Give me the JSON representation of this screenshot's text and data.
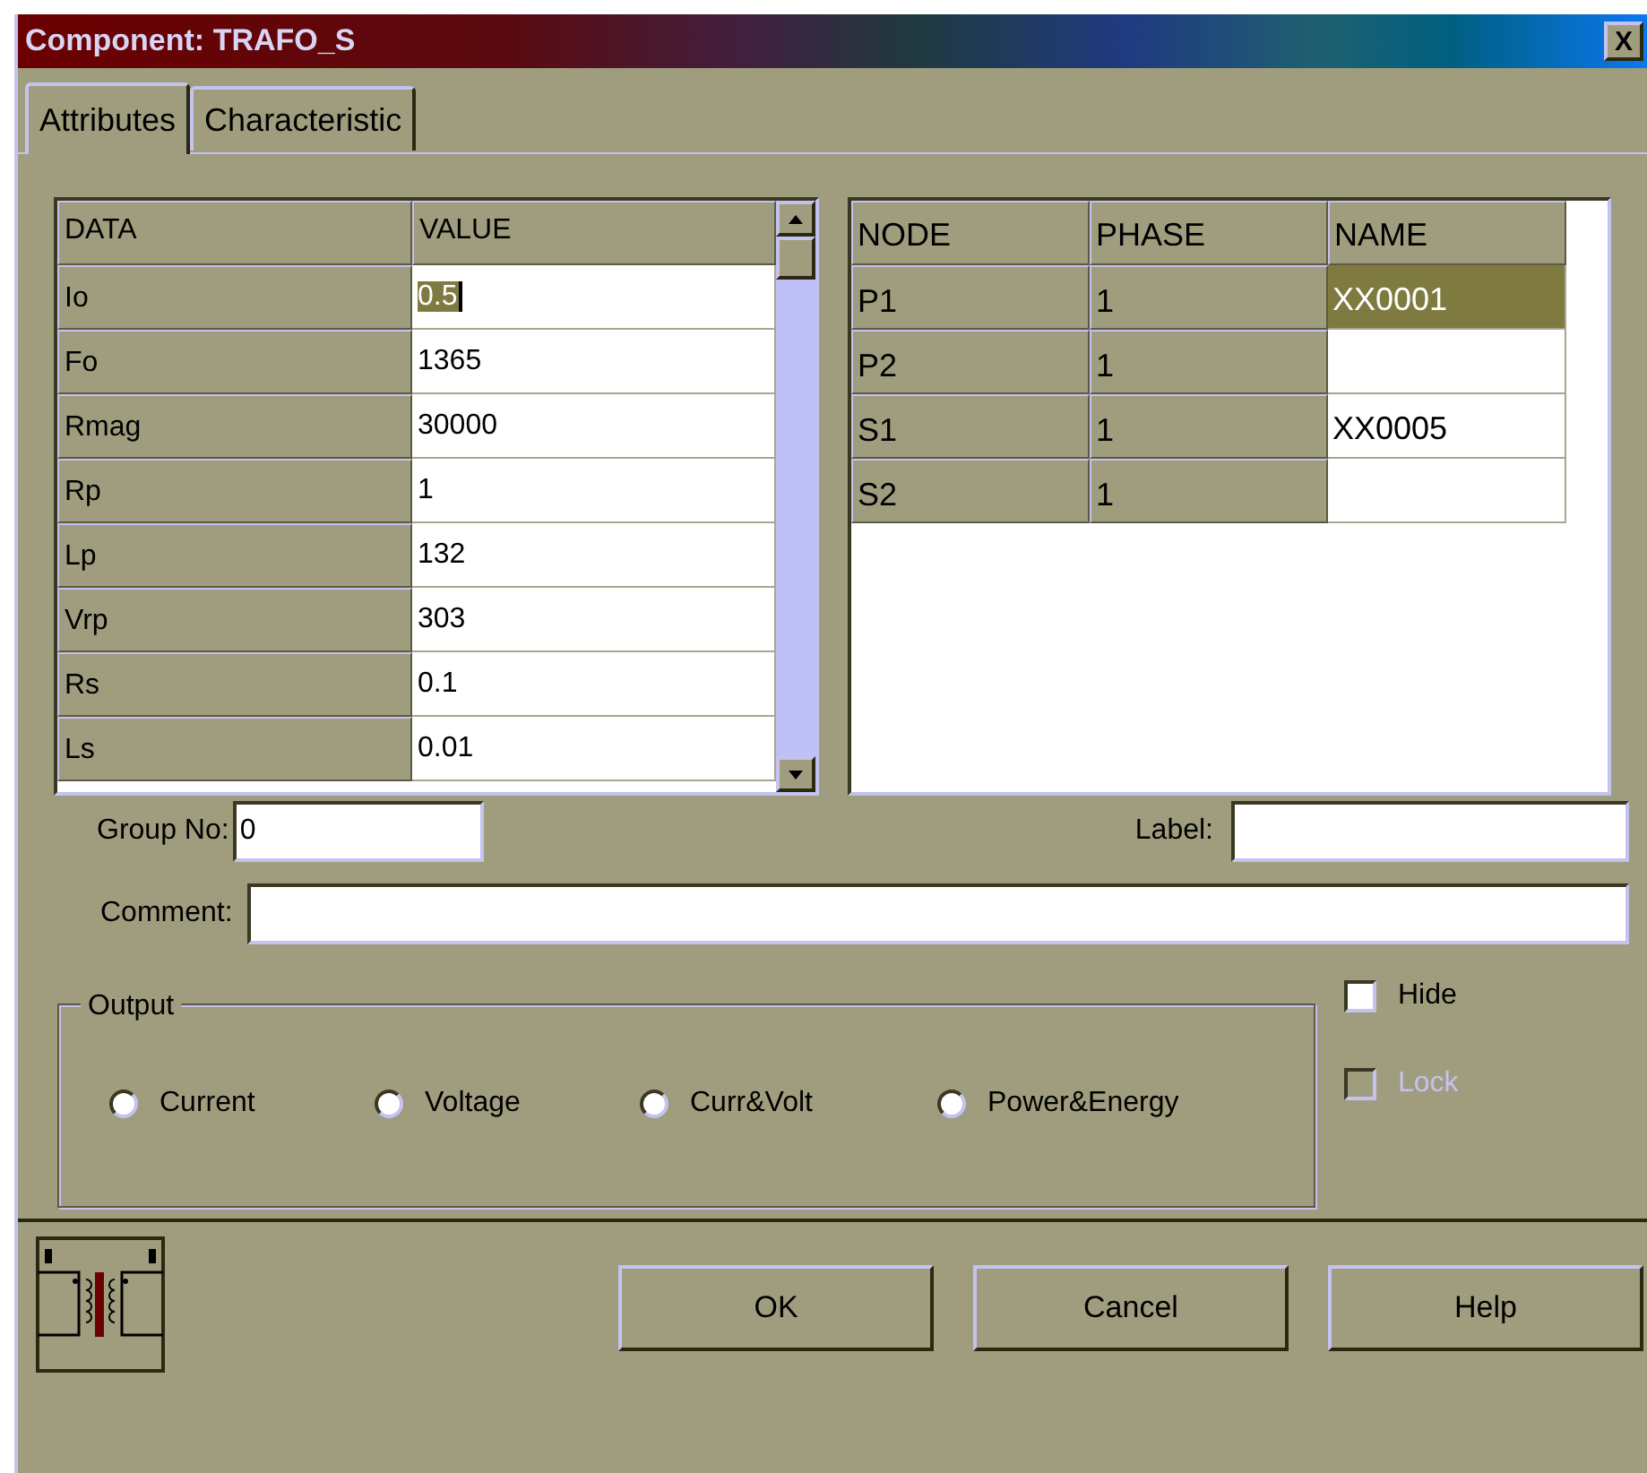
{
  "window": {
    "title": "Component: TRAFO_S",
    "close": "X"
  },
  "tabs": [
    {
      "label": "Attributes",
      "selected": true
    },
    {
      "label": "Characteristic",
      "selected": false
    }
  ],
  "data_table": {
    "columns": [
      "DATA",
      "VALUE"
    ],
    "rows": [
      {
        "data": "Io",
        "value": "0.5",
        "selected": true
      },
      {
        "data": "Fo",
        "value": "1365",
        "selected": false
      },
      {
        "data": "Rmag",
        "value": "30000",
        "selected": false
      },
      {
        "data": "Rp",
        "value": "1",
        "selected": false
      },
      {
        "data": "Lp",
        "value": "132",
        "selected": false
      },
      {
        "data": "Vrp",
        "value": "303",
        "selected": false
      },
      {
        "data": "Rs",
        "value": "0.1",
        "selected": false
      },
      {
        "data": "Ls",
        "value": "0.01",
        "selected": false
      }
    ]
  },
  "node_table": {
    "columns": [
      "NODE",
      "PHASE",
      "NAME"
    ],
    "rows": [
      {
        "node": "P1",
        "phase": "1",
        "name": "XX0001",
        "selected": true
      },
      {
        "node": "P2",
        "phase": "1",
        "selected": false
      },
      {
        "node": "S1",
        "phase": "1",
        "name": "XX0005",
        "selected": false
      },
      {
        "node": "S2",
        "phase": "1",
        "selected": false
      }
    ]
  },
  "group_no": {
    "label": "Group No:",
    "value": "0"
  },
  "label_field": {
    "label": "Label:"
  },
  "comment": {
    "label": "Comment:"
  },
  "output": {
    "title": "Output",
    "options": [
      {
        "label": "Current",
        "selected": false
      },
      {
        "label": "Voltage",
        "selected": false
      },
      {
        "label": "Curr&Volt",
        "selected": false
      },
      {
        "label": "Power&Energy",
        "selected": false
      }
    ]
  },
  "checkboxes": [
    {
      "label": "Hide",
      "checked": false,
      "disabled": false
    },
    {
      "label": "Lock",
      "checked": false,
      "disabled": true
    }
  ],
  "buttons": [
    "OK",
    "Cancel",
    "Help"
  ]
}
